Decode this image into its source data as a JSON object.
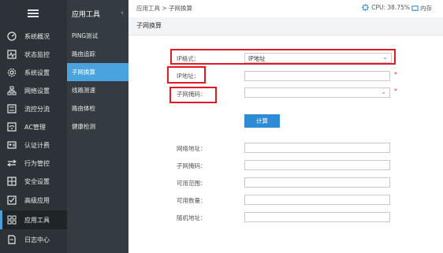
{
  "sidebar": {
    "items": [
      {
        "label": "系统概况",
        "icon": "dashboard-icon"
      },
      {
        "label": "状态监控",
        "icon": "monitor-icon"
      },
      {
        "label": "系统设置",
        "icon": "gear-icon"
      },
      {
        "label": "网络设置",
        "icon": "network-icon"
      },
      {
        "label": "流控分流",
        "icon": "traffic-icon"
      },
      {
        "label": "AC管理",
        "icon": "wifi-icon"
      },
      {
        "label": "认证计费",
        "icon": "id-card-icon"
      },
      {
        "label": "行为管控",
        "icon": "arrows-icon"
      },
      {
        "label": "安全设置",
        "icon": "shield-icon"
      },
      {
        "label": "高级应用",
        "icon": "checkbox-icon"
      },
      {
        "label": "应用工具",
        "icon": "tools-icon",
        "active": true
      },
      {
        "label": "日志中心",
        "icon": "document-icon"
      }
    ]
  },
  "subnav": {
    "title": "应用工具",
    "items": [
      {
        "label": "PING测试"
      },
      {
        "label": "路由追踪"
      },
      {
        "label": "子网换算",
        "active": true
      },
      {
        "label": "线路测速"
      },
      {
        "label": "路由体检"
      },
      {
        "label": "健康检测"
      }
    ]
  },
  "topbar": {
    "breadcrumb": "应用工具 > 子网换算",
    "cpu": "CPU: 38.75%",
    "mem": "内存"
  },
  "page": {
    "title": "子网换算"
  },
  "form": {
    "ip_format_label": "IP格式：",
    "ip_format_value": "IP地址",
    "ip_address_label": "IP地址：",
    "subnet_mask_label": "子网掩码：",
    "required_mark": "*",
    "calc_button": "计算",
    "network_address_label": "网络地址：",
    "result_mask_label": "子网掩码：",
    "usable_range_label": "可用范围：",
    "usable_count_label": "可用数量：",
    "broadcast_address_label": "随机地址："
  },
  "colors": {
    "sidebar_bg": "#2c3237",
    "active_sub": "#4aa3df",
    "button": "#2e8bd6",
    "highlight": "#e01b24"
  }
}
